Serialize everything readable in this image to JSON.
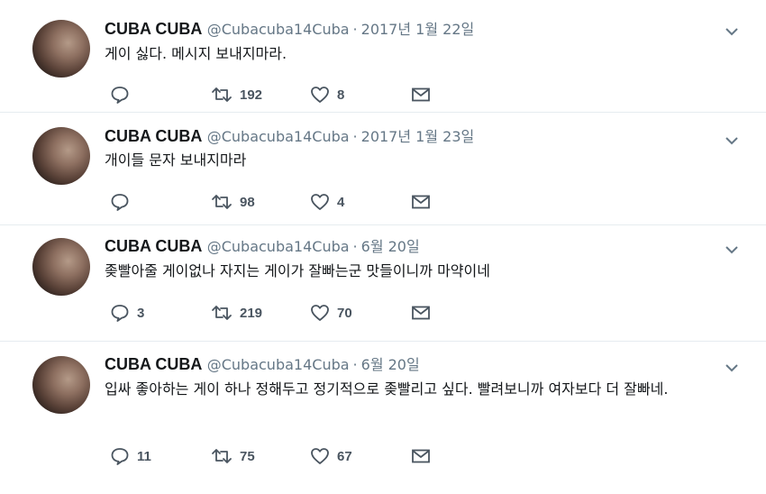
{
  "tweets": [
    {
      "name": "CUBA CUBA",
      "handle": "@Cubacuba14Cuba",
      "separator": "·",
      "date": "2017년 1월 22일",
      "text": "게이 싫다. 메시지 보내지마라.",
      "replies": "",
      "retweets": "192",
      "likes": "8"
    },
    {
      "name": "CUBA CUBA",
      "handle": "@Cubacuba14Cuba",
      "separator": "·",
      "date": "2017년 1월 23일",
      "text": "개이들 문자 보내지마라",
      "replies": "",
      "retweets": "98",
      "likes": "4"
    },
    {
      "name": "CUBA CUBA",
      "handle": "@Cubacuba14Cuba",
      "separator": "·",
      "date": "6월 20일",
      "text": "좆빨아줄 게이없나 자지는 게이가 잘빠는군 맛들이니까 마약이네",
      "replies": "3",
      "retweets": "219",
      "likes": "70"
    },
    {
      "name": "CUBA CUBA",
      "handle": "@Cubacuba14Cuba",
      "separator": "·",
      "date": "6월 20일",
      "text": "입싸 좋아하는 게이 하나 정해두고 정기적으로 좆빨리고 싶다. 빨려보니까 여자보다 더 잘빠네.",
      "replies": "11",
      "retweets": "75",
      "likes": "67"
    }
  ],
  "icons": {
    "reply": "reply-icon",
    "retweet": "retweet-icon",
    "like": "heart-icon",
    "message": "envelope-icon",
    "more": "chevron-down-icon"
  },
  "colors": {
    "text": "#14171a",
    "secondary": "#657786",
    "divider": "#e6ecf0"
  }
}
